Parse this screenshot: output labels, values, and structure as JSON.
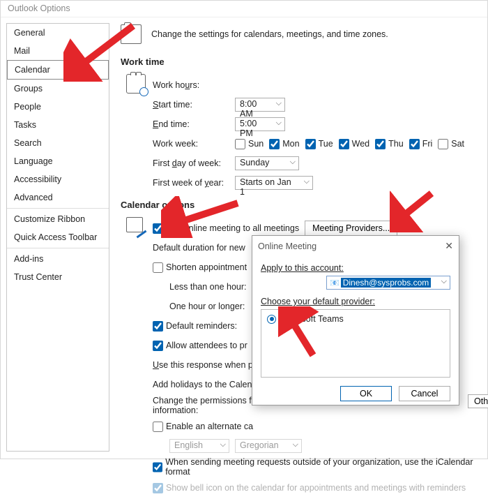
{
  "window": {
    "title": "Outlook Options"
  },
  "sidebar": {
    "items": [
      {
        "label": "General"
      },
      {
        "label": "Mail"
      },
      {
        "label": "Calendar"
      },
      {
        "label": "Groups"
      },
      {
        "label": "People"
      },
      {
        "label": "Tasks"
      },
      {
        "label": "Search"
      },
      {
        "label": "Language"
      },
      {
        "label": "Accessibility"
      },
      {
        "label": "Advanced"
      },
      {
        "label": "Customize Ribbon"
      },
      {
        "label": "Quick Access Toolbar"
      },
      {
        "label": "Add-ins"
      },
      {
        "label": "Trust Center"
      }
    ]
  },
  "intro": {
    "text": "Change the settings for calendars, meetings, and time zones."
  },
  "worktime": {
    "title": "Work time",
    "hours_label": "Work hours:",
    "start_label": "Start time:",
    "start_value": "8:00 AM",
    "end_label": "End time:",
    "end_value": "5:00 PM",
    "workweek_label": "Work week:",
    "days": {
      "sun": "Sun",
      "mon": "Mon",
      "tue": "Tue",
      "wed": "Wed",
      "thu": "Thu",
      "fri": "Fri",
      "sat": "Sat"
    },
    "checked": {
      "sun": false,
      "mon": true,
      "tue": true,
      "wed": true,
      "thu": true,
      "fri": true,
      "sat": false
    },
    "firstday_label": "First day of week:",
    "firstday_value": "Sunday",
    "firstweek_label": "First week of year:",
    "firstweek_value": "Starts on Jan 1"
  },
  "calopts": {
    "title": "Calendar options",
    "addonline_label": "Add online meeting to all meetings",
    "meetingproviders_btn": "Meeting Providers...",
    "defaultdur_label": "Default duration for new",
    "shorten_label": "Shorten appointment",
    "lessthan_label": "Less than one hour:",
    "onehour_label": "One hour or longer:",
    "defrem_label": "Default reminders:",
    "allowatt_label": "Allow attendees to pr",
    "useresp_label": "Use this response when pr",
    "holidays_label": "Add holidays to the Calen",
    "changeperm_label": "Change the permissions for\ninformation:",
    "altcal_label": "Enable an alternate ca",
    "lang_value": "English",
    "caltype_value": "Gregorian",
    "ical_label": "When sending meeting requests outside of your organization, use the iCalendar format",
    "bellicon_label": "Show bell icon on the calendar for appointments and meetings with reminders"
  },
  "modal": {
    "title": "Online Meeting",
    "apply_label": "Apply to this account:",
    "account_value": "Dinesh@sysprobs.com",
    "choose_label": "Choose your default provider:",
    "provider": "Microsoft Teams",
    "ok": "OK",
    "cancel": "Cancel"
  },
  "other_btn": "Oth"
}
